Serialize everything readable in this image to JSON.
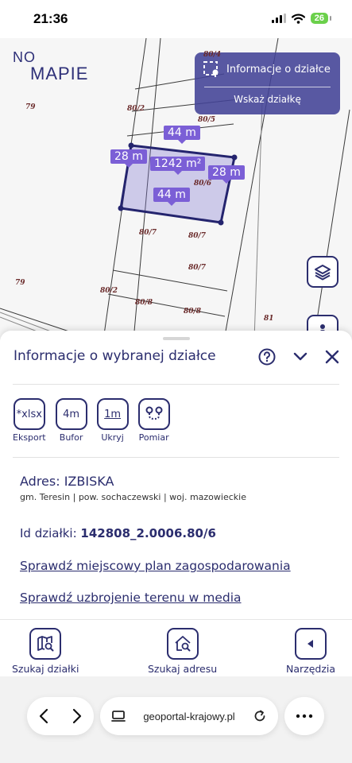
{
  "status": {
    "time": "21:36",
    "battery": "26"
  },
  "map": {
    "logo_line1": "NO",
    "logo_line2": "MAPIE",
    "info_panel": {
      "title": "Informacje o działce",
      "action": "Wskaż działkę"
    },
    "measurements": {
      "top": "44 m",
      "bottom": "44 m",
      "left": "28 m",
      "right": "28 m",
      "area": "1242 m²"
    },
    "plot_labels": [
      "79",
      "80/2",
      "80/5",
      "80/6",
      "80/7",
      "80/7",
      "80/7",
      "79",
      "80/2",
      "80/8",
      "80/8",
      "81",
      "80/4"
    ]
  },
  "sheet": {
    "title": "Informacje o wybranej działce",
    "tools": [
      {
        "icon": "*xlsx",
        "label": "Eksport"
      },
      {
        "icon": "4m",
        "label": "Bufor"
      },
      {
        "icon": "1m",
        "label": "Ukryj"
      },
      {
        "icon": "",
        "label": "Pomiar"
      }
    ],
    "address": "Adres: IZBISKA",
    "address_sub": "gm. Teresin | pow. sochaczewski | woj. mazowieckie",
    "parcel_label": "Id działki: ",
    "parcel_id": "142808_2.0006.80/6",
    "link_plan": "Sprawdź miejscowy plan zagospodarowania",
    "link_media": "Sprawdź uzbrojenie terenu w media"
  },
  "nav": {
    "search_parcel": "Szukaj działki",
    "search_address": "Szukaj adresu",
    "tools": "Narzędzia"
  },
  "browser": {
    "url": "geoportal-krajowy.pl"
  },
  "colors": {
    "primary": "#2b2d6e",
    "measure": "#7b5fd6",
    "panel": "#424296",
    "battery": "#6bd04b"
  }
}
